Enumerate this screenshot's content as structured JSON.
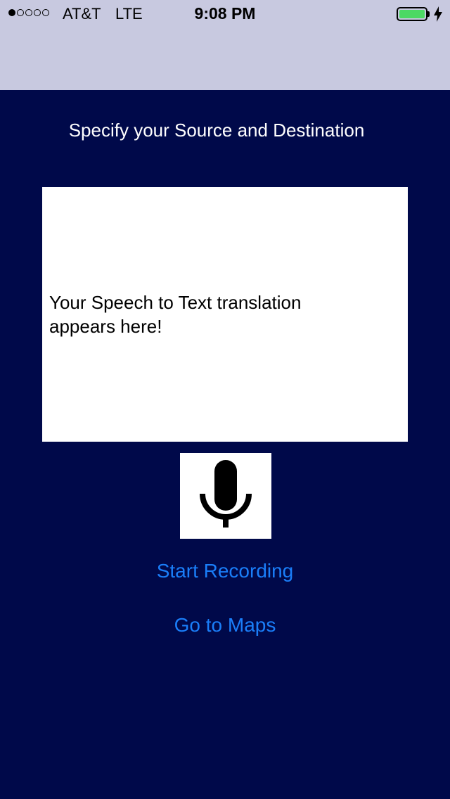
{
  "status_bar": {
    "signal_dots_total": 5,
    "signal_dots_filled": 1,
    "carrier": "AT&T",
    "network": "LTE",
    "time": "9:08 PM",
    "battery_level": 1.0,
    "icons": {
      "signal": "signal-strength-dots-icon",
      "battery": "battery-icon",
      "charging": "charging-bolt-icon"
    }
  },
  "main": {
    "heading": "Specify your Source and Destination",
    "transcript_placeholder": "Your Speech to Text translation appears here!",
    "mic_icon": "microphone-icon",
    "start_recording_label": "Start Recording",
    "go_to_maps_label": "Go to Maps"
  },
  "colors": {
    "background": "#00094a",
    "bars": "#c8c9e0",
    "link": "#1a7ef9",
    "battery_fill": "#4cd964"
  }
}
